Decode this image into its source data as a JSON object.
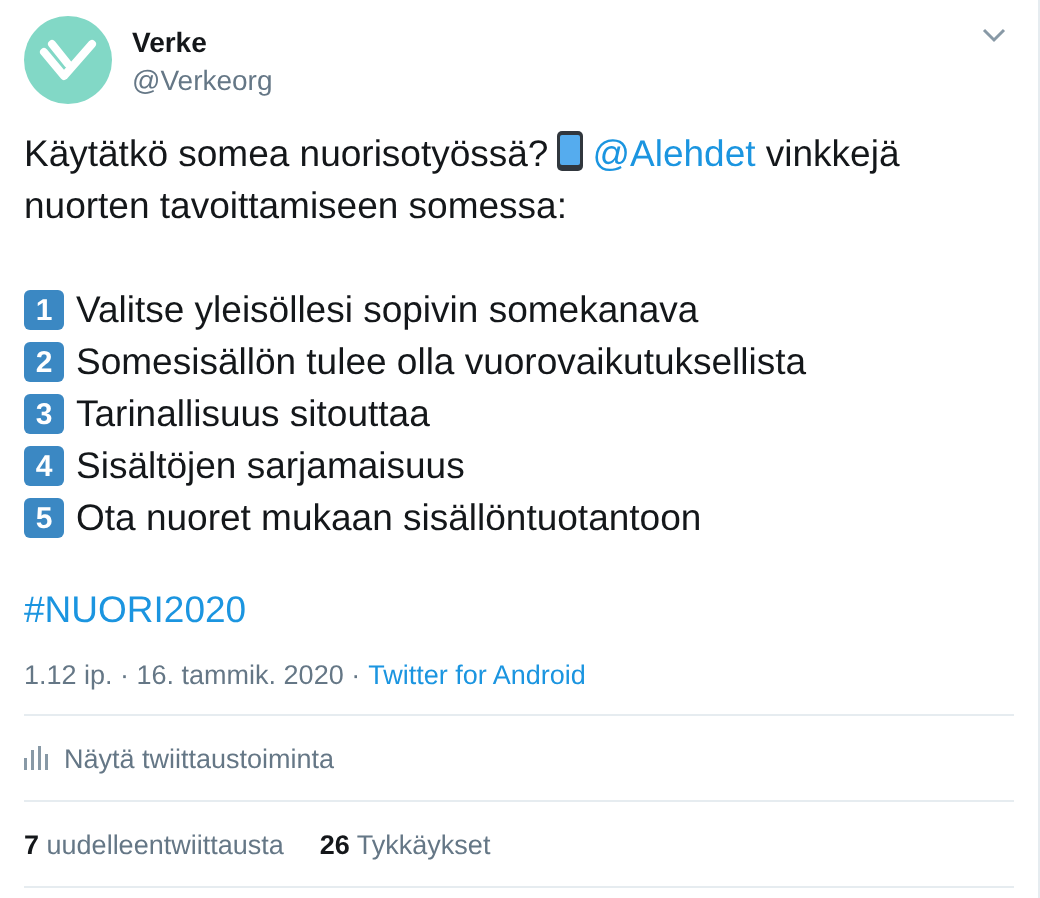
{
  "author": {
    "name": "Verke",
    "handle": "@Verkeorg"
  },
  "intro": {
    "before": "Käytätkö somea nuorisotyössä?",
    "mention": "@Alehdet",
    "after": "vinkkejä nuorten tavoittamiseen somessa:"
  },
  "tips": [
    {
      "number": "1",
      "text": "Valitse yleisöllesi sopivin somekanava"
    },
    {
      "number": "2",
      "text": "Somesisällön tulee olla vuorovaikutuksellista"
    },
    {
      "number": "3",
      "text": "Tarinallisuus sitouttaa"
    },
    {
      "number": "4",
      "text": "Sisältöjen sarjamaisuus"
    },
    {
      "number": "5",
      "text": "Ota nuoret mukaan sisällöntuotantoon"
    }
  ],
  "hashtag": "#NUORI2020",
  "meta": {
    "time": "1.12 ip. · 16. tammik. 2020 ·",
    "source": "Twitter for Android"
  },
  "analytics": "Näytä twiittaustoiminta",
  "stats": [
    {
      "count": "7",
      "label": "uudelleentwiittausta"
    },
    {
      "count": "26",
      "label": "Tykkäykset"
    }
  ]
}
